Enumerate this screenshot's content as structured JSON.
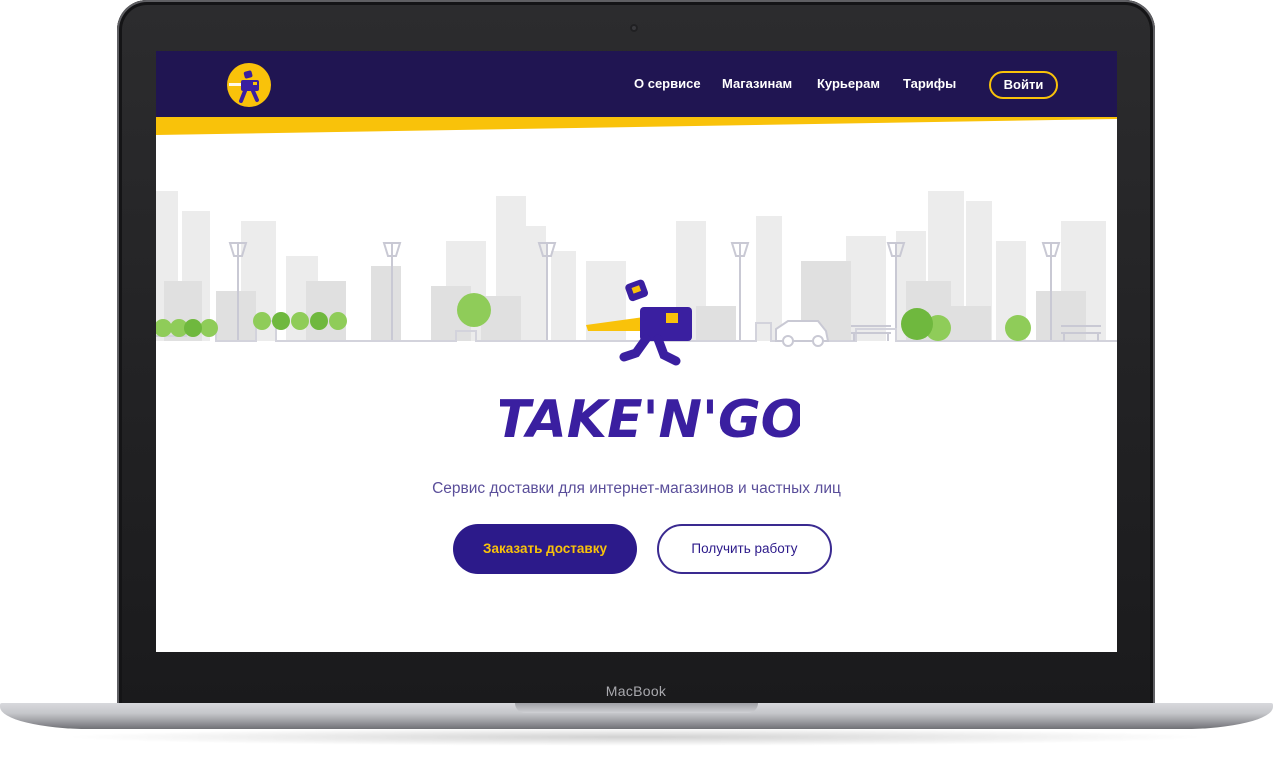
{
  "device": {
    "bezel_label": "MacBook"
  },
  "nav": {
    "links": [
      "О сервисе",
      "Магазинам",
      "Курьерам",
      "Тарифы"
    ],
    "login_label": "Войти"
  },
  "hero": {
    "brand_wordmark": "TAKE'N'GO",
    "tagline": "Сервис доставки для интернет-магазинов и частных лиц",
    "primary_cta": "Заказать доставку",
    "secondary_cta": "Получить работу"
  },
  "colors": {
    "brand_navy": "#201552",
    "brand_purple": "#3a1fa0",
    "brand_yellow": "#f9c20a",
    "tree_green": "#8fcc59"
  },
  "icons": [
    "courier-logo-icon",
    "courier-mascot-icon"
  ]
}
